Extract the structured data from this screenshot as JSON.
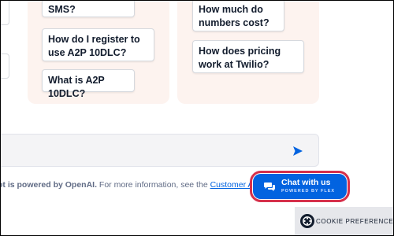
{
  "suggestions": {
    "left": [
      {
        "label": "SMS?"
      },
      {
        "label": "How do I register to use A2P 10DLC?"
      },
      {
        "label": "What is A2P 10DLC?"
      }
    ],
    "right": [
      {
        "label": "How much do numbers cost?"
      },
      {
        "label": "How does pricing work at Twilio?"
      }
    ]
  },
  "chat_input": {
    "placeholder": "",
    "send_icon": "send-icon"
  },
  "footer": {
    "powered_prefix": "ot is powered by OpenAI.",
    "info_text": " For more information, see the ",
    "link_text": "Customer AI Tr"
  },
  "chat_widget": {
    "title": "Chat with us",
    "subtitle": "POWERED BY FLEX",
    "icon": "chat-bubbles-icon",
    "accent": "#0263e0",
    "highlight": "#d6304b"
  },
  "cookie": {
    "label": "COOKIE PREFERENCES",
    "icon": "cookie-icon"
  }
}
